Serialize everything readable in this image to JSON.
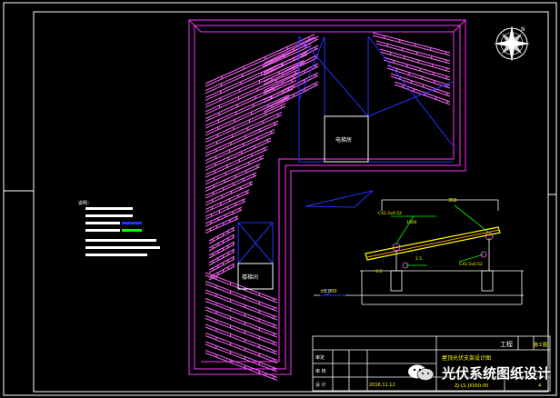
{
  "drawing": {
    "colors": {
      "background": "#000000",
      "frame": "#ffffff",
      "building": "#ff33ff",
      "panels": "#ff66ff",
      "wiring": "#2233ff",
      "text_yellow": "#ffff00",
      "accent_green": "#00ff00"
    },
    "rooms": {
      "elevator_room": "电梯房",
      "stair_room": "楼梯间"
    },
    "notes": {
      "heading": "说明："
    },
    "section": {
      "ground_label": "±0.000",
      "dim_labels": {
        "top_center": "350",
        "left_upper": "2.5",
        "top_left": "1500",
        "left_lower": "3.5",
        "mid_left": "C41.5x0.52",
        "mid_right": "C41.5x0.52"
      }
    },
    "title_block": {
      "project_label": "工程",
      "drawing_name": "屋顶光伏支架设计图",
      "approve": "审定",
      "check": "审 核",
      "design": "设 计",
      "date": "2016.11.12",
      "drawing_no": "ZJ-LS-JX000-00",
      "sheet": "4",
      "stage_label": "施工图"
    },
    "compass": {
      "label": "N"
    },
    "watermark": {
      "text": "光伏系统图纸设计",
      "logo": "wechat-icon"
    }
  }
}
